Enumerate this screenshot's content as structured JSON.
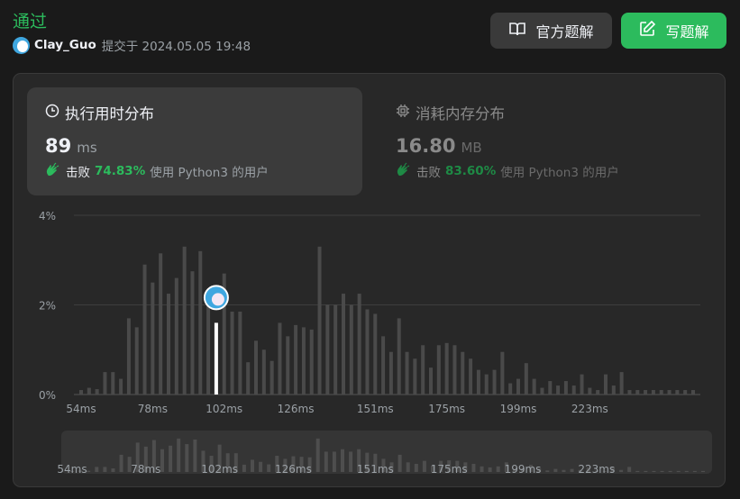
{
  "header": {
    "status": "通过",
    "username": "Clay_Guo",
    "submitted_text": "提交于 2024.05.05 19:48",
    "official_solution_label": "官方题解",
    "write_solution_label": "写题解"
  },
  "runtime_card": {
    "title": "执行用时分布",
    "value": "89",
    "unit": "ms",
    "beats_label": "击败",
    "beats_pct": "74.83%",
    "beats_tail": "使用 Python3 的用户"
  },
  "memory_card": {
    "title": "消耗内存分布",
    "value": "16.80",
    "unit": "MB",
    "beats_label": "击败",
    "beats_pct": "83.60%",
    "beats_tail": "使用 Python3 的用户"
  },
  "colors": {
    "accent": "#2cbb5d",
    "bar": "#4a4a4a",
    "highlight": "#ffffff",
    "grid": "#3e3e3e"
  },
  "chart_data": {
    "type": "bar",
    "title": "",
    "xlabel": "",
    "ylabel": "",
    "ylim": [
      0,
      4
    ],
    "yticks": [
      "0%",
      "2%",
      "4%"
    ],
    "xticks": [
      "54ms",
      "78ms",
      "102ms",
      "126ms",
      "151ms",
      "175ms",
      "199ms",
      "223ms"
    ],
    "highlight_index": 17,
    "highlight_label": "89 ms",
    "values": [
      0.1,
      0.15,
      0.12,
      0.5,
      0.5,
      0.35,
      1.7,
      1.5,
      2.9,
      2.5,
      3.15,
      2.25,
      2.6,
      3.3,
      2.75,
      3.2,
      2.1,
      1.6,
      2.7,
      1.85,
      1.85,
      0.72,
      1.2,
      1.0,
      0.75,
      1.6,
      1.3,
      1.55,
      1.5,
      1.45,
      3.3,
      2.0,
      2.0,
      2.25,
      2.0,
      2.25,
      1.9,
      1.8,
      1.3,
      0.95,
      1.7,
      0.95,
      0.8,
      1.1,
      0.6,
      1.1,
      1.15,
      1.1,
      0.95,
      0.8,
      0.55,
      0.45,
      0.55,
      0.95,
      0.25,
      0.35,
      0.7,
      0.35,
      0.15,
      0.3,
      0.2,
      0.3,
      0.2,
      0.45,
      0.15,
      0.1,
      0.45,
      0.2,
      0.5,
      0.1,
      0.1,
      0.1,
      0.1,
      0.1,
      0.1,
      0.1,
      0.1,
      0.1
    ]
  }
}
